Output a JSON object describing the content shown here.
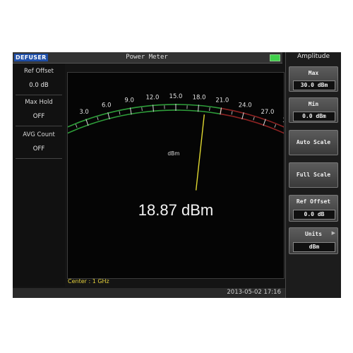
{
  "header": {
    "logo_text": "DEFUSER",
    "title": "Power Meter",
    "battery_color": "#3fd04a"
  },
  "left_panel": {
    "items": [
      {
        "label": "Ref Offset",
        "value": "0.0 dB"
      },
      {
        "label": "Max Hold",
        "value": "OFF"
      },
      {
        "label": "AVG Count",
        "value": "OFF"
      }
    ]
  },
  "gauge": {
    "unit_label": "dBm",
    "reading": "18.87 dBm",
    "needle_value": 18.87,
    "scale_min": 0.0,
    "scale_max": 30.0,
    "ticks": [
      "0.0",
      "3.0",
      "6.0",
      "9.0",
      "12.0",
      "15.0",
      "18.0",
      "21.0",
      "24.0",
      "27.0",
      "30.0"
    ],
    "green_to": 21.0,
    "colors": {
      "green_zone": "#2e9e3a",
      "red_zone": "#8c2323",
      "needle": "#e0d830",
      "tick": "#d8d8d8"
    }
  },
  "footer": {
    "center": "Center : 1 GHz",
    "datetime": "2013-05-02 17:16"
  },
  "softkeys": {
    "menu_title": "Amplitude",
    "max_label": "Max",
    "max_value": "30.0 dBm",
    "min_label": "Min",
    "min_value": "0.0 dBm",
    "auto_scale": "Auto Scale",
    "full_scale": "Full Scale",
    "ref_offset_label": "Ref Offset",
    "ref_offset_value": "0.0 dB",
    "units_label": "Units",
    "units_value": "dBm",
    "units_arrow_icon": "triangle-right-icon"
  }
}
